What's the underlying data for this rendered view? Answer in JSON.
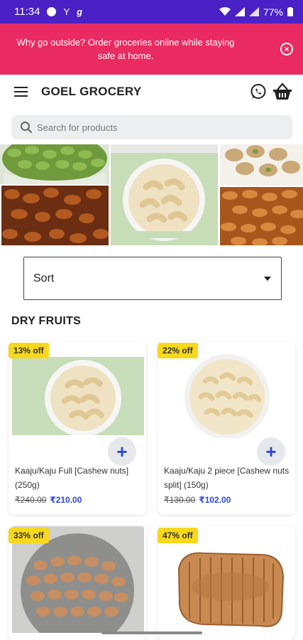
{
  "status": {
    "time": "11:34",
    "battery": "77%"
  },
  "promo": {
    "text": "Why go outside? Order groceries online while staying safe at home."
  },
  "appbar": {
    "title": "GOEL GROCERY"
  },
  "search": {
    "placeholder": "Search for products"
  },
  "sort": {
    "label": "Sort"
  },
  "section": {
    "title": "DRY FRUITS"
  },
  "products": [
    {
      "badge": "13% off",
      "name": "Kaaju/Kaju Full [Cashew nuts] (250g)",
      "old_price": "₹240.00",
      "new_price": "₹210.00"
    },
    {
      "badge": "22% off",
      "name": "Kaaju/Kaju 2 piece [Cashew nuts split] (150g)",
      "old_price": "₹130.00",
      "new_price": "₹102.00"
    },
    {
      "badge": "33% off",
      "name": "",
      "old_price": "",
      "new_price": ""
    },
    {
      "badge": "47% off",
      "name": "",
      "old_price": "",
      "new_price": ""
    }
  ],
  "colors": {
    "status_bar": "#4a21c4",
    "promo": "#ea2a62",
    "badge": "#f7d81d",
    "price": "#2e48d6"
  },
  "icons": [
    "menu-icon",
    "whatsapp-icon",
    "basket-icon",
    "search-icon",
    "close-icon",
    "plus-icon",
    "caret-down-icon"
  ]
}
